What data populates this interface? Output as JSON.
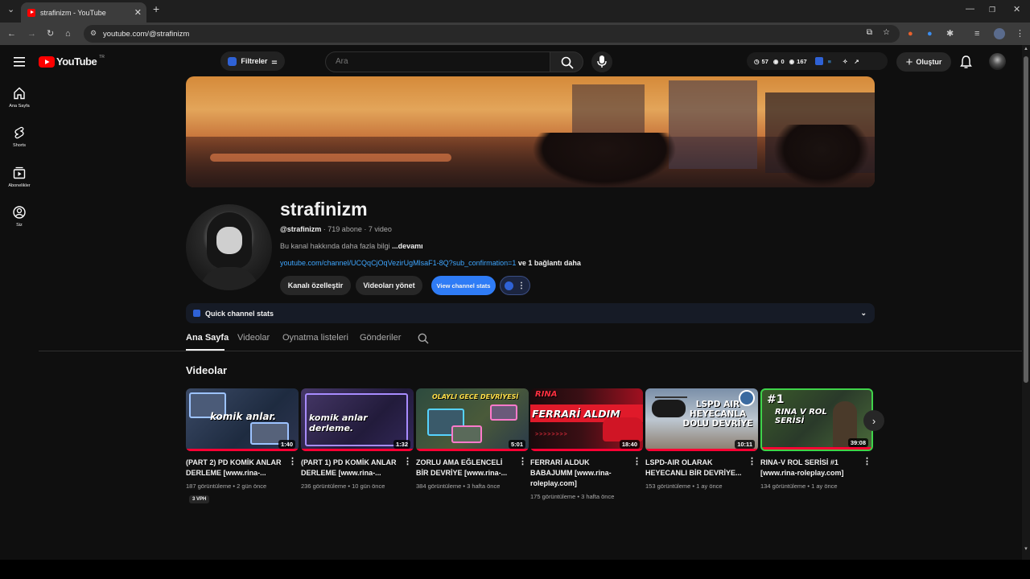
{
  "browser": {
    "tab_title": "strafinizm - YouTube",
    "url": "youtube.com/@strafinizm"
  },
  "header": {
    "logo": "YouTube",
    "country": "TR",
    "filter_label": "Filtreler",
    "search_placeholder": "Ara",
    "stats": {
      "a": "57",
      "b": "0",
      "c": "167"
    },
    "create_label": "Oluştur"
  },
  "sidebar": {
    "items": [
      {
        "label": "Ana Sayfa",
        "icon": "home-icon"
      },
      {
        "label": "Shorts",
        "icon": "shorts-icon"
      },
      {
        "label": "Abonelikler",
        "icon": "subscriptions-icon"
      },
      {
        "label": "Siz",
        "icon": "you-icon"
      }
    ]
  },
  "channel": {
    "name": "strafinizm",
    "handle": "@strafinizm",
    "subs": " · 719 abone · 7 video",
    "about": "Bu kanal hakkında daha fazla bilgi",
    "more": " ...devamı",
    "link": "youtube.com/channel/UCQqCjOqVezirUgMlsaF1-8Q?sub_confirmation=1",
    "link_more": " ve 1 bağlantı daha",
    "btn_customize": "Kanalı özelleştir",
    "btn_manage": "Videoları yönet",
    "btn_stats": "View channel stats",
    "quick_stats": "Quick channel stats"
  },
  "tabs": [
    "Ana Sayfa",
    "Videolar",
    "Oynatma listeleri",
    "Gönderiler"
  ],
  "section_title": "Videolar",
  "videos": [
    {
      "title": "(PART 2) PD KOMİK ANLAR DERLEME [www.rina-...",
      "meta": "187 görüntüleme • 2 gün önce",
      "duration": "1:40",
      "badge": "3 VPH",
      "thumb_text": "komik anlar."
    },
    {
      "title": "(PART 1) PD KOMİK ANLAR DERLEME [www.rina-...",
      "meta": "236 görüntüleme • 10 gün önce",
      "duration": "1:32",
      "thumb_text": "komik anlar derleme."
    },
    {
      "title": "ZORLU AMA EĞLENCELİ BİR DEVRİYE [www.rina-...",
      "meta": "384 görüntüleme • 3 hafta önce",
      "duration": "5:01",
      "thumb_text": "OLAYLI GECE DEVRİYESİ"
    },
    {
      "title": "FERRARİ ALDUK BABAJUMM [www.rina-roleplay.com]",
      "meta": "175 görüntüleme • 3 hafta önce",
      "duration": "18:40",
      "thumb_text": "FERRARİ ALDIM",
      "thumb_sub": "RINA"
    },
    {
      "title": "LSPD-AIR OLARAK HEYECANLI BİR DEVRİYE...",
      "meta": "153 görüntüleme • 1 ay önce",
      "duration": "10:11",
      "thumb_text": "LSPD AIR HEYECANLA DOLU DEVRİYE"
    },
    {
      "title": "RINA-V ROL SERİSİ #1 [www.rina-roleplay.com]",
      "meta": "134 görüntüleme • 1 ay önce",
      "duration": "39:08",
      "thumb_text": "RINA V ROL SERİSİ",
      "thumb_sub": "#1"
    }
  ],
  "colors": {
    "accent": "#3ea6ff",
    "stats_button": "#2f7cf6",
    "youtube_red": "#ff0000"
  }
}
